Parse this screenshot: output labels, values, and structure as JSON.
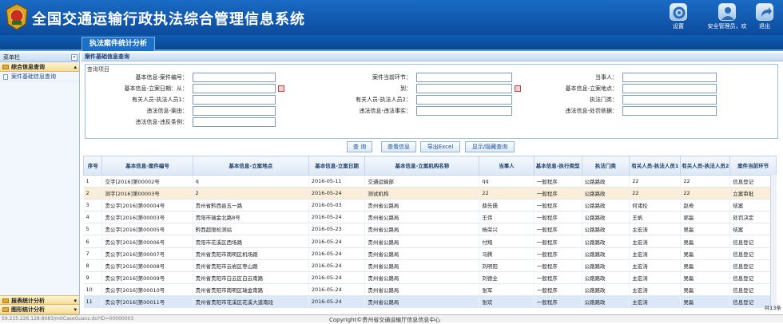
{
  "header": {
    "title": "全国交通运输行政执法综合管理信息系统",
    "buttons": [
      "设置",
      "安全管理员，欢",
      "退出"
    ],
    "accent": "#0b4b9e"
  },
  "tabs": [
    "执法案件统计分析"
  ],
  "sidebar": {
    "title": "菜单栏",
    "group": "综合信息查询",
    "items": [
      "案件基础信息查询"
    ],
    "bottom": [
      "报表统计分析",
      "图形统计分析"
    ]
  },
  "content": {
    "title": "案件基础信息查询",
    "legend": "查询项目"
  },
  "form": {
    "fields": [
      {
        "label": "基本信息-案件编号：",
        "col": 0,
        "row": 0
      },
      {
        "label": "案件当前环节：",
        "col": 1,
        "row": 0
      },
      {
        "label": "当事人：",
        "col": 2,
        "row": 0
      },
      {
        "label": "基本信息-立案日期：从：",
        "col": 0,
        "row": 1
      },
      {
        "label": "到：",
        "col": 1,
        "row": 1
      },
      {
        "label": "基本信息-立案地点：",
        "col": 2,
        "row": 1
      },
      {
        "label": "有关人员-执法人员1：",
        "col": 0,
        "row": 2
      },
      {
        "label": "有关人员-执法人员2：",
        "col": 1,
        "row": 2
      },
      {
        "label": "执法门类：",
        "col": 2,
        "row": 2
      },
      {
        "label": "违法信息-案由：",
        "col": 0,
        "row": 3
      },
      {
        "label": "违法信息-违法事实：",
        "col": 1,
        "row": 3
      },
      {
        "label": "违法信息-处罚依据：",
        "col": 2,
        "row": 3
      },
      {
        "label": "违法信息-违反条例：",
        "col": 0,
        "row": 4
      }
    ]
  },
  "buttons": [
    "查 询",
    "查看信息",
    "导出Excel",
    "显示/隐藏查询"
  ],
  "table": {
    "headers": [
      "序号",
      "基本信息-案件编号",
      "基本信息-立案地点",
      "基本信息-立案日期",
      "基本信息-立案机构名称",
      "当事人",
      "基本信息-执行类型",
      "执法门类",
      "有关人员-执法人员1",
      "有关人员-执法人员2",
      "案件当前环节"
    ],
    "rows": [
      [
        "1",
        "交字[2016]第00002号",
        "q",
        "2016-05-11",
        "交通运输部",
        "qq",
        "一般程序",
        "公路路政",
        "22",
        "22",
        "信息登记"
      ],
      [
        "2",
        "测字[2016]第00003号",
        "2",
        "2016-05-24",
        "测试机构",
        "22",
        "一般程序",
        "公路路政",
        "22",
        "22",
        "立案审批"
      ],
      [
        "3",
        "贵公字[2016]第00004号",
        "贵州省黔西县五一路",
        "2016-05-03",
        "贵州省公路局",
        "薛先儒",
        "一般程序",
        "公路路政",
        "何诸伦",
        "赵奇",
        "结案"
      ],
      [
        "4",
        "贵公字[2016]第00003号",
        "贵阳市瑞金北路8号",
        "2016-05-24",
        "贵州省公路局",
        "王伟",
        "一般程序",
        "公路路政",
        "王帆",
        "郭磊",
        "处罚决定"
      ],
      [
        "5",
        "贵公字[2016]第00005号",
        "黔西超限检测站",
        "2016-05-23",
        "贵州省公路局",
        "杨荣兴",
        "一般程序",
        "公路路政",
        "主宏涛",
        "吴磊",
        "结案"
      ],
      [
        "6",
        "贵公字[2016]第00006号",
        "贵阳市花溪区西场路",
        "2016-05-24",
        "贵州省公路局",
        "付翔",
        "一般程序",
        "公路路政",
        "主宏涛",
        "吴磊",
        "信息登记"
      ],
      [
        "7",
        "贵公字[2016]第00007号",
        "贵州省贵阳市南明区机场路",
        "2016-05-24",
        "贵州省公路局",
        "马腾",
        "一般程序",
        "公路路政",
        "主宏涛",
        "吴磊",
        "信息登记"
      ],
      [
        "8",
        "贵公字[2016]第00008号",
        "贵州省贵阳市云岩区枣山路",
        "2016-05-24",
        "贵州省公路局",
        "刘明阳",
        "一般程序",
        "公路路政",
        "主宏涛",
        "吴磊",
        "信息登记"
      ],
      [
        "9",
        "贵公字[2016]第00009号",
        "贵州省贵阳市白云区白云南路",
        "2016-05-24",
        "贵州省公路局",
        "刘德全",
        "一般程序",
        "公路路政",
        "主宏涛",
        "吴磊",
        "信息登记"
      ],
      [
        "10",
        "贵公字[2016]第00010号",
        "贵州省贵阳市南明区瑞金南路",
        "2016-05-24",
        "贵州省公路局",
        "张军",
        "一般程序",
        "公路路政",
        "主宏涛",
        "吴磊",
        "信息登记"
      ],
      [
        "11",
        "贵公字[2016]第00011号",
        "贵州省贵阳市花溪区花溪大道南段",
        "2016-05-24",
        "贵州省公路局",
        "张欢",
        "一般程序",
        "公路路政",
        "主宏涛",
        "吴磊",
        "信息登记"
      ]
    ],
    "pager": "共13条"
  },
  "footer": {
    "url": "59.215.226.128:8083/mitCaseGuanz.do?ID=00000003",
    "copyright": "Copyright©贵州省交通运输厅信息信息中心"
  }
}
